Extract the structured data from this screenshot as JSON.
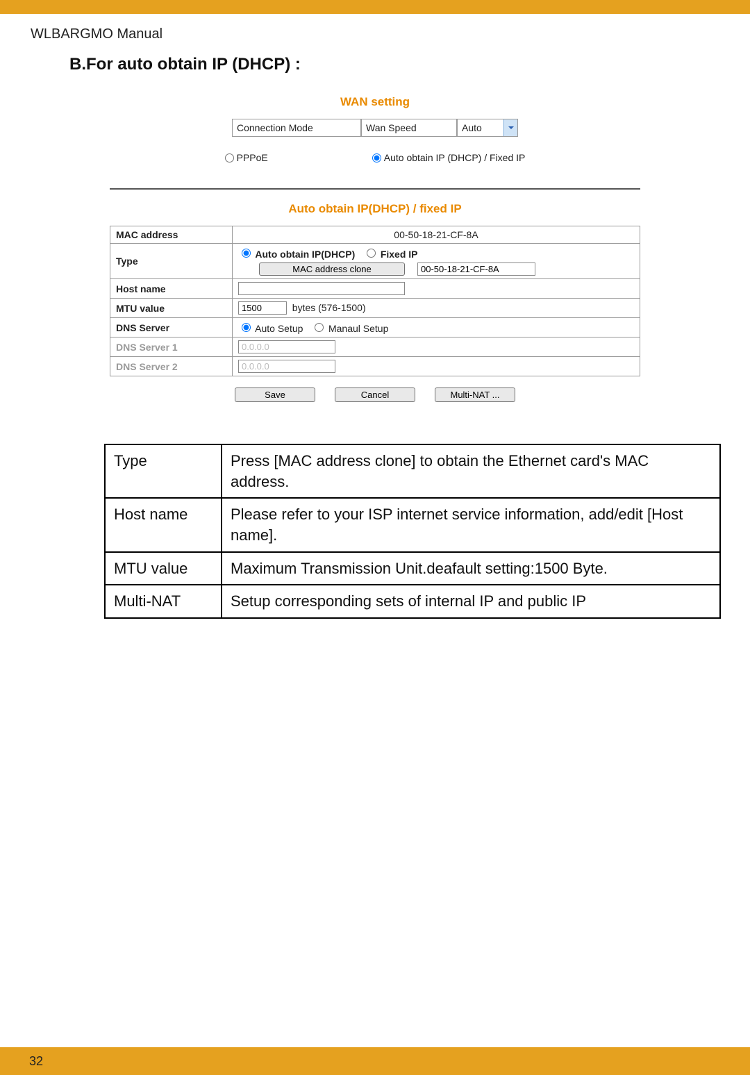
{
  "header": {
    "manual_title": "WLBARGMO Manual"
  },
  "section": {
    "heading": "B.For auto obtain IP (DHCP) :"
  },
  "screenshot": {
    "wan_title": "WAN setting",
    "connection_mode_label": "Connection Mode",
    "wan_speed_label": "Wan Speed",
    "wan_speed_value": "Auto",
    "radio_pppoe": "PPPoE",
    "radio_auto_fixed": "Auto obtain IP (DHCP) / Fixed IP",
    "auto_title": "Auto obtain IP(DHCP) / fixed IP",
    "rows": {
      "mac_address": {
        "key": "MAC address",
        "value": "00-50-18-21-CF-8A"
      },
      "type": {
        "key": "Type",
        "opt_auto": "Auto obtain IP(DHCP)",
        "opt_fixed": "Fixed IP",
        "clone_btn": "MAC address clone",
        "clone_value": "00-50-18-21-CF-8A"
      },
      "host_name": {
        "key": "Host name",
        "value": ""
      },
      "mtu": {
        "key": "MTU value",
        "value": "1500",
        "suffix": "bytes (576-1500)"
      },
      "dns": {
        "key": "DNS Server",
        "opt_auto": "Auto Setup",
        "opt_manual": "Manaul Setup"
      },
      "dns1": {
        "key": "DNS Server 1",
        "value": "0.0.0.0"
      },
      "dns2": {
        "key": "DNS Server 2",
        "value": "0.0.0.0"
      }
    },
    "buttons": {
      "save": "Save",
      "cancel": "Cancel",
      "multinat": "Multi-NAT ..."
    }
  },
  "desc_table": {
    "rows": [
      {
        "k": "Type",
        "v": "Press [MAC address clone] to obtain the Ethernet card's MAC address."
      },
      {
        "k": "Host name",
        "v": "Please refer to your ISP internet service information, add/edit [Host name]."
      },
      {
        "k": "MTU value",
        "v": "Maximum Transmission Unit.deafault setting:1500 Byte."
      },
      {
        "k": "Multi-NAT",
        "v": "Setup corresponding sets of internal IP and public IP"
      }
    ]
  },
  "footer": {
    "page_number": "32"
  }
}
